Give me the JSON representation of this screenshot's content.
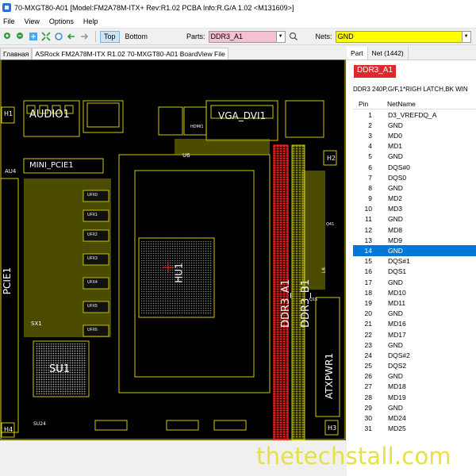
{
  "window": {
    "title": "70-MXGT80-A01 [Model:FM2A78M-ITX+ Rev:R1.02 PCBA Info:R.G/A 1.02    <M131609>]"
  },
  "menu": [
    "File",
    "View",
    "Options",
    "Help"
  ],
  "toolbar": {
    "top_label": "Top",
    "bottom_label": "Bottom",
    "parts_label": "Parts:",
    "parts_value": "DDR3_A1",
    "nets_label": "Nets:",
    "nets_value": "GND",
    "icons": [
      "zoom-in-icon",
      "zoom-out-icon",
      "zoom-fit-icon",
      "zoom-area-icon",
      "rotate-icon",
      "back-arrow-icon",
      "forward-arrow-icon"
    ]
  },
  "tabs": [
    {
      "label": "Главная",
      "active": false
    },
    {
      "label": "ASRock FM2A78M-ITX  R1.02 70-MXGT80-A01 BoardView File",
      "active": true
    }
  ],
  "board": {
    "labels": {
      "audio": "AUDIO1",
      "vga": "VGA_DVI1",
      "mini_pcie": "MINI_PCIE1",
      "pcie": "PCIE1",
      "hu": "HU1",
      "ddr_a": "DDR3_A1",
      "ddr_b": "DDR3_B1",
      "su1": "SU1",
      "atx": "ATXPWR1",
      "h1": "H1",
      "h2": "H2",
      "h3": "H3",
      "h4": "H4",
      "au4": "AU4",
      "sx1": "SX1",
      "su24": "SU24",
      "u6": "U6",
      "hdmi1": "HDMI1",
      "q16": "Q16",
      "q41": "Q41",
      "l6": "L6"
    },
    "fet_labels": [
      "UFX0",
      "UFX1",
      "UFX2",
      "UFX3",
      "UFX4",
      "UFX5",
      "UFX6"
    ]
  },
  "side_panel": {
    "tabs": [
      {
        "label": "Part",
        "active": true
      },
      {
        "label": "Net (1442)",
        "active": false
      }
    ],
    "part_name": "DDR3_A1",
    "part_desc": "DDR3 240P,G/F,1*RIGH LATCH,BK WIN",
    "columns": {
      "pin": "Pin",
      "net": "NetName"
    },
    "selected_pin": 14,
    "pins": [
      {
        "pin": "1",
        "net": "D3_VREFDQ_A"
      },
      {
        "pin": "2",
        "net": "GND"
      },
      {
        "pin": "3",
        "net": "MD0"
      },
      {
        "pin": "4",
        "net": "MD1"
      },
      {
        "pin": "5",
        "net": "GND"
      },
      {
        "pin": "6",
        "net": "DQS#0"
      },
      {
        "pin": "7",
        "net": "DQS0"
      },
      {
        "pin": "8",
        "net": "GND"
      },
      {
        "pin": "9",
        "net": "MD2"
      },
      {
        "pin": "10",
        "net": "MD3"
      },
      {
        "pin": "11",
        "net": "GND"
      },
      {
        "pin": "12",
        "net": "MD8"
      },
      {
        "pin": "13",
        "net": "MD9"
      },
      {
        "pin": "14",
        "net": "GND"
      },
      {
        "pin": "15",
        "net": "DQS#1"
      },
      {
        "pin": "16",
        "net": "DQS1"
      },
      {
        "pin": "17",
        "net": "GND"
      },
      {
        "pin": "18",
        "net": "MD10"
      },
      {
        "pin": "19",
        "net": "MD11"
      },
      {
        "pin": "20",
        "net": "GND"
      },
      {
        "pin": "21",
        "net": "MD16"
      },
      {
        "pin": "22",
        "net": "MD17"
      },
      {
        "pin": "23",
        "net": "GND"
      },
      {
        "pin": "24",
        "net": "DQS#2"
      },
      {
        "pin": "25",
        "net": "DQS2"
      },
      {
        "pin": "26",
        "net": "GND"
      },
      {
        "pin": "27",
        "net": "MD18"
      },
      {
        "pin": "28",
        "net": "MD19"
      },
      {
        "pin": "29",
        "net": "GND"
      },
      {
        "pin": "30",
        "net": "MD24"
      },
      {
        "pin": "31",
        "net": "MD25"
      }
    ]
  },
  "watermark": "thetechstall.com",
  "colors": {
    "board_bg": "#000000",
    "silkscreen": "#ffffff",
    "outline": "#e8e000",
    "highlight": "#ff2020",
    "part_badge": "#e0282a",
    "nets_bg": "#ffff00",
    "parts_bg": "#f4c0d4",
    "selection": "#0078d7"
  }
}
